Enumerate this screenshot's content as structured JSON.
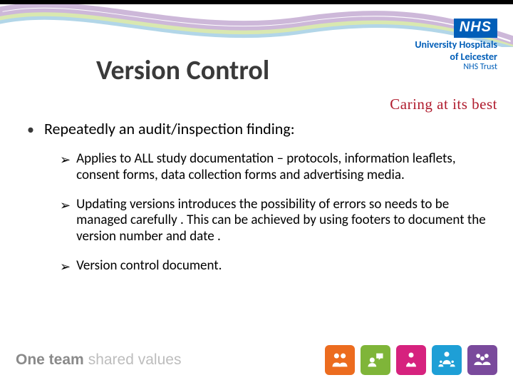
{
  "header": {
    "title": "Version Control",
    "nhs_logo": "NHS",
    "nhs_line1": "University Hospitals",
    "nhs_line2": "of Leicester",
    "nhs_trust": "NHS Trust",
    "tagline": "Caring at its best"
  },
  "content": {
    "main_bullet": "Repeatedly an audit/inspection finding:",
    "subs": [
      "Applies to ALL  study documentation – protocols, information leaflets, consent forms, data collection forms and advertising media.",
      "Updating versions introduces the possibility of errors so needs to be managed carefully . This can be achieved by using footers to document the version number and date .",
      "Version control document."
    ]
  },
  "footer": {
    "brand_main": "One team",
    "brand_sub": "shared values",
    "icon_colors": [
      "#ec6c1f",
      "#7fb539",
      "#d6227e",
      "#1e9fd6",
      "#7a4a9c"
    ]
  }
}
